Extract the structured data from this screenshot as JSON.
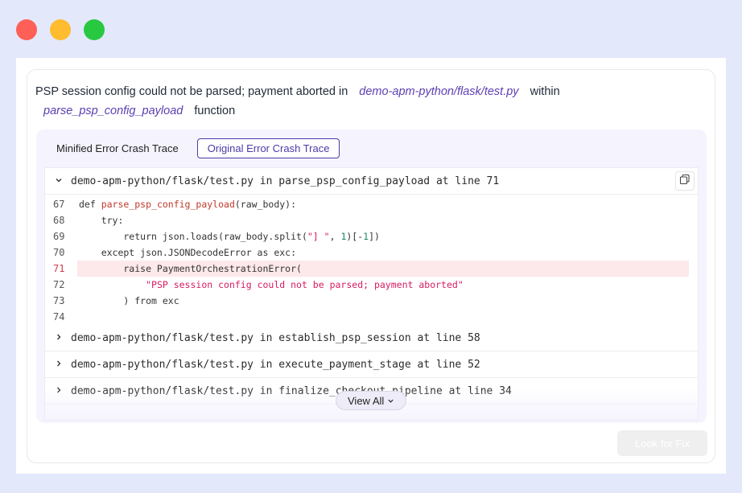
{
  "window_controls": {
    "close": "#fe5f57",
    "minimize": "#febc2e",
    "maximize": "#28c840"
  },
  "error": {
    "message_prefix": "PSP session config could not be parsed; payment aborted in",
    "file_path": "demo-apm-python/flask/test.py",
    "within_text": "within",
    "function_name": "parse_psp_config_payload",
    "function_text": "function"
  },
  "tabs": [
    {
      "label": "Minified Error Crash Trace",
      "active": false
    },
    {
      "label": "Original Error Crash Trace",
      "active": true
    }
  ],
  "frames": [
    {
      "label": "demo-apm-python/flask/test.py in parse_psp_config_payload at line 71",
      "expanded": true
    },
    {
      "label": "demo-apm-python/flask/test.py in establish_psp_session at line 58",
      "expanded": false
    },
    {
      "label": "demo-apm-python/flask/test.py in execute_payment_stage at line 52",
      "expanded": false
    },
    {
      "label": "demo-apm-python/flask/test.py in finalize_checkout_pipeline at line 34",
      "expanded": false
    }
  ],
  "code": {
    "highlight_line": "71",
    "lines": [
      {
        "n": "67",
        "kw": "def ",
        "fn": "parse_psp_config_payload",
        "rest": "(raw_body):"
      },
      {
        "n": "68",
        "text": "    try:"
      },
      {
        "n": "69",
        "a": "        return json.loads(raw_body.split(",
        "s": "\"] \"",
        "b": ", ",
        "num1": "1",
        "c": ")[-",
        "num2": "1",
        "d": "])"
      },
      {
        "n": "70",
        "text": "    except json.JSONDecodeError as exc:"
      },
      {
        "n": "71",
        "text": "        raise PaymentOrchestrationError("
      },
      {
        "n": "72",
        "pre": "            ",
        "str": "\"PSP session config could not be parsed; payment aborted\""
      },
      {
        "n": "73",
        "text": "        ) from exc"
      },
      {
        "n": "74",
        "text": ""
      }
    ]
  },
  "view_all_label": "View All",
  "look_for_fix_label": "Look for Fix",
  "icons": {
    "copy": "copy-icon",
    "chevron_down": "chevron-down-icon",
    "chevron_right": "chevron-right-icon"
  }
}
